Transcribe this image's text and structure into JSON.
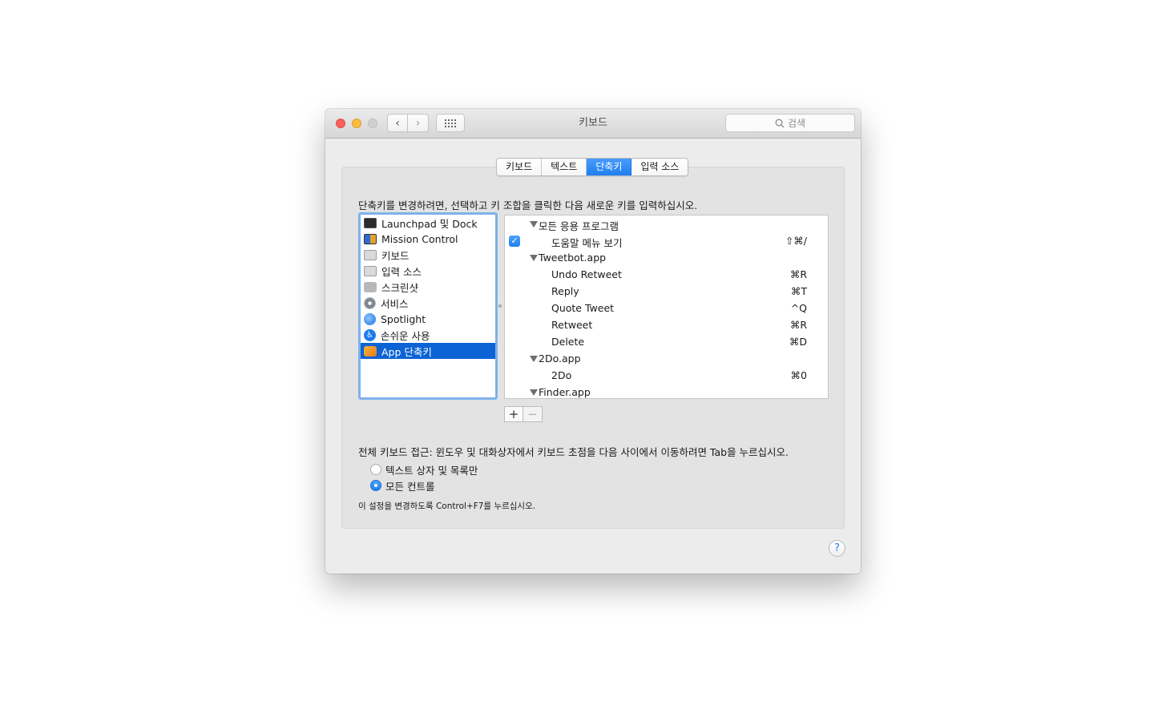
{
  "window": {
    "title": "키보드"
  },
  "search": {
    "placeholder": "검색"
  },
  "tabs": [
    {
      "label": "키보드",
      "active": false
    },
    {
      "label": "텍스트",
      "active": false
    },
    {
      "label": "단축키",
      "active": true
    },
    {
      "label": "입력 소스",
      "active": false
    }
  ],
  "instructions": "단축키를 변경하려면, 선택하고 키 조합을 클릭한 다음 새로운 키를 입력하십시오.",
  "categories": [
    {
      "label": "Launchpad 및 Dock",
      "icon": "dock-icon"
    },
    {
      "label": "Mission Control",
      "icon": "mission-control-icon"
    },
    {
      "label": "키보드",
      "icon": "keyboard-icon"
    },
    {
      "label": "입력 소스",
      "icon": "input-source-icon"
    },
    {
      "label": "스크린샷",
      "icon": "screenshot-icon"
    },
    {
      "label": "서비스",
      "icon": "gear-icon"
    },
    {
      "label": "Spotlight",
      "icon": "spotlight-icon"
    },
    {
      "label": "손쉬운 사용",
      "icon": "accessibility-icon"
    },
    {
      "label": "App 단축키",
      "icon": "app-shortcuts-icon",
      "selected": true
    }
  ],
  "shortcuts": {
    "group_all": "모든 응용 프로그램",
    "help_menu": {
      "label": "도움말 메뉴 보기",
      "key": "⇧⌘/",
      "checked": true
    },
    "group_tweetbot": "Tweetbot.app",
    "undo_retweet": {
      "label": "Undo Retweet",
      "key": "⌘R"
    },
    "reply": {
      "label": "Reply",
      "key": "⌘T"
    },
    "quote_tweet": {
      "label": "Quote Tweet",
      "key": "^Q"
    },
    "retweet": {
      "label": "Retweet",
      "key": "⌘R"
    },
    "delete": {
      "label": "Delete",
      "key": "⌘D"
    },
    "group_2do": "2Do.app",
    "todo": {
      "label": "2Do",
      "key": "⌘0"
    },
    "group_finder": "Finder.app"
  },
  "buttons": {
    "add": "+",
    "remove": "−"
  },
  "full_keyboard_access": "전체 키보드 접근: 윈도우 및 대화상자에서 키보드 초점을 다음 사이에서 이동하려면 Tab을 누르십시오.",
  "radio_options": [
    {
      "label": "텍스트 상자 및 목록만",
      "selected": false
    },
    {
      "label": "모든 컨트롤",
      "selected": true
    }
  ],
  "note": "이 설정을 변경하도록 Control+F7를 누르십시오.",
  "help_button": "?"
}
